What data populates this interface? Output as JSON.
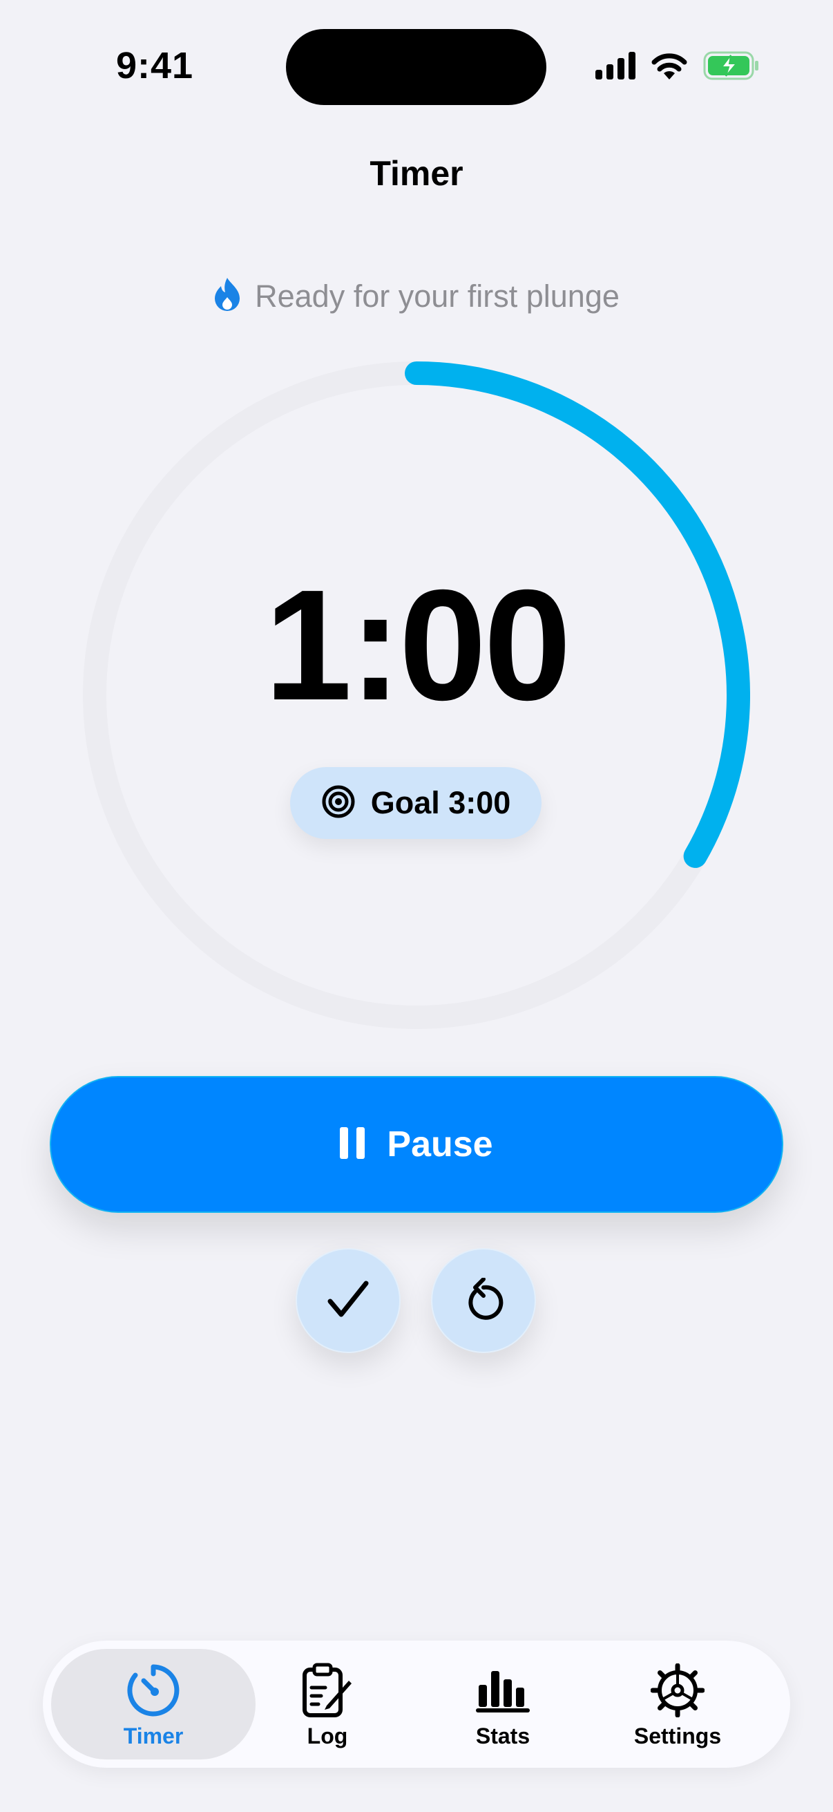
{
  "status_bar": {
    "time": "9:41"
  },
  "nav": {
    "title": "Timer"
  },
  "streak": {
    "icon": "flame-icon",
    "text": "Ready for your first plunge"
  },
  "timer": {
    "display": "1:00",
    "goal_label": "Goal 3:00",
    "progress_fraction": 0.3333,
    "ring_color": "#00b1ee",
    "track_color": "#ececf1"
  },
  "controls": {
    "pause_label": "Pause",
    "primary_color": "#0086ff",
    "finish_icon": "checkmark-icon",
    "reset_icon": "reset-arrow-icon"
  },
  "tab_bar": {
    "active_color": "#1a83e6",
    "tabs": [
      {
        "label": "Timer",
        "icon": "timer-icon",
        "active": true
      },
      {
        "label": "Log",
        "icon": "clipboard-icon",
        "active": false
      },
      {
        "label": "Stats",
        "icon": "chart-bars-icon",
        "active": false
      },
      {
        "label": "Settings",
        "icon": "gear-icon",
        "active": false
      }
    ]
  }
}
